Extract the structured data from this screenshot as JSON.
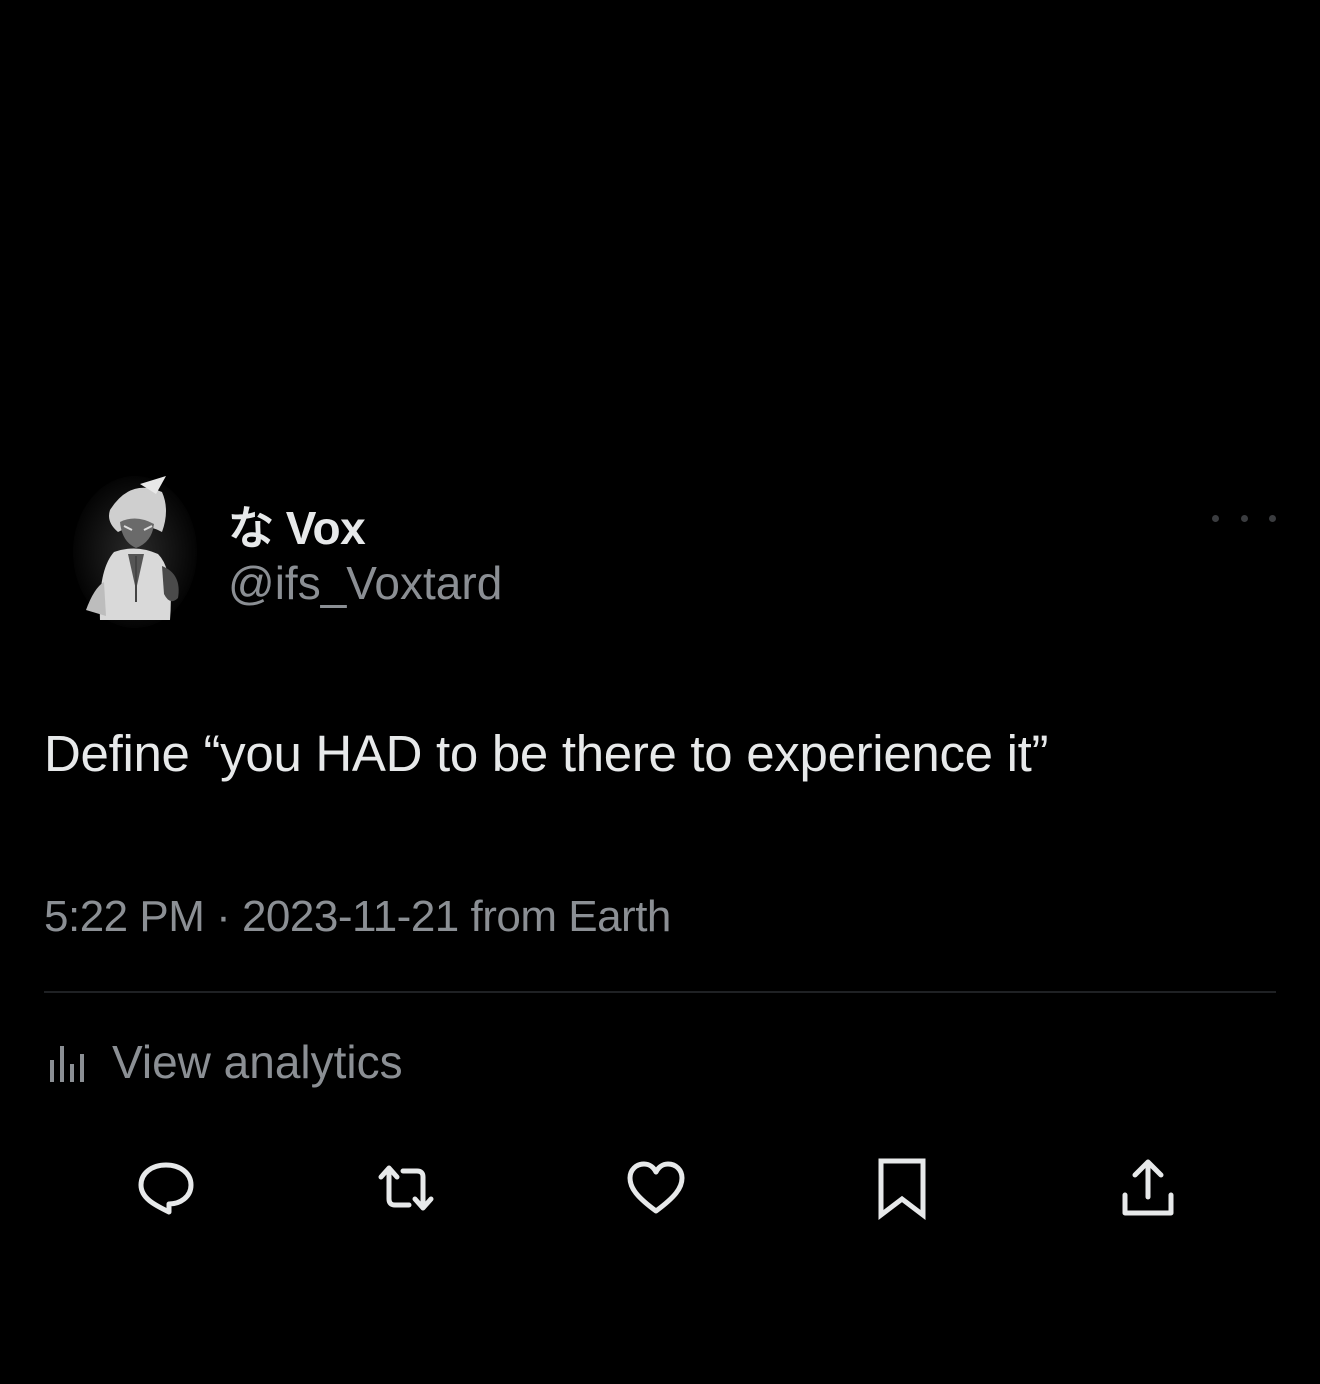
{
  "tweet": {
    "author": {
      "display_name": "な Vox",
      "handle": "@ifs_Voxtard",
      "avatar_icon": "anime-character-avatar"
    },
    "text": "Define “you HAD to be there to experience it”",
    "meta": "5:22 PM · 2023-11-21 from Earth",
    "analytics_label": "View analytics",
    "actions": [
      {
        "name": "reply",
        "icon": "comment-icon"
      },
      {
        "name": "retweet",
        "icon": "retweet-icon"
      },
      {
        "name": "like",
        "icon": "heart-icon"
      },
      {
        "name": "bookmark",
        "icon": "bookmark-icon"
      },
      {
        "name": "share",
        "icon": "share-icon"
      }
    ]
  },
  "colors": {
    "background": "#000000",
    "primary_text": "#e7e9ea",
    "secondary_text": "#8b8f94",
    "divider": "#1f2124"
  }
}
